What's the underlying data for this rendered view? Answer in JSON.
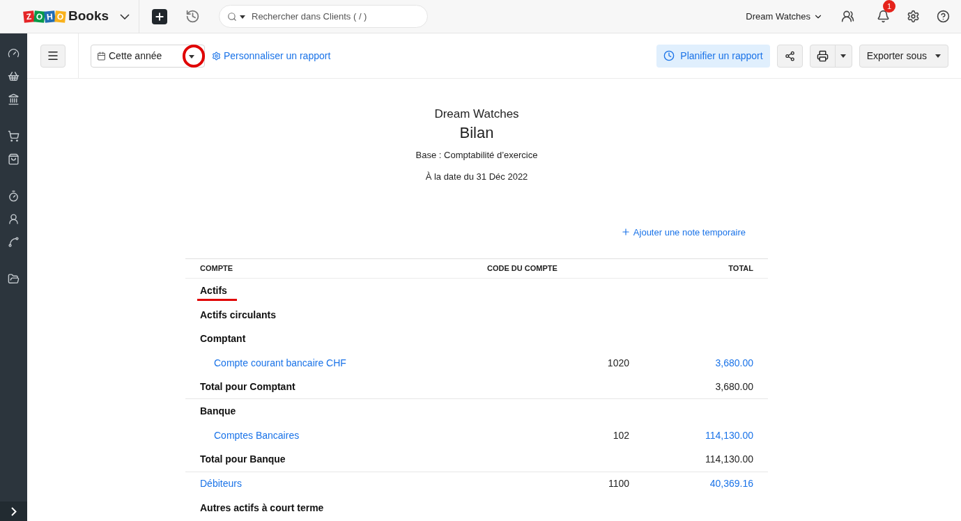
{
  "topbar": {
    "logo_letters": [
      {
        "letter": "Z",
        "color": "#e42527"
      },
      {
        "letter": "O",
        "color": "#089949"
      },
      {
        "letter": "H",
        "color": "#226db4"
      },
      {
        "letter": "O",
        "color": "#f9b21d"
      }
    ],
    "product": "Books",
    "search_placeholder": "Rechercher dans Clients ( / )",
    "organization": "Dream Watches",
    "notification_count": "1"
  },
  "toolbar": {
    "period": "Cette année",
    "customize": "Personnaliser un rapport",
    "schedule": "Planifier un rapport",
    "export": "Exporter sous"
  },
  "report": {
    "company": "Dream Watches",
    "title": "Bilan",
    "basis": "Base : Comptabilité d’exercice",
    "date": "À la date du 31 Déc 2022",
    "add_note": "Ajouter une note temporaire",
    "columns": [
      "COMPTE",
      "CODE DU COMPTE",
      "TOTAL"
    ],
    "rows": [
      {
        "kind": "heading",
        "label": "Actifs"
      },
      {
        "kind": "heading",
        "label": "Actifs circulants"
      },
      {
        "kind": "heading",
        "label": "Comptant"
      },
      {
        "kind": "account",
        "label": "Compte courant bancaire CHF",
        "code": "1020",
        "total": "3,680.00"
      },
      {
        "kind": "total",
        "label": "Total pour Comptant",
        "total": "3,680.00"
      },
      {
        "kind": "heading",
        "label": "Banque"
      },
      {
        "kind": "account",
        "label": "Comptes Bancaires",
        "code": "102",
        "total": "114,130.00"
      },
      {
        "kind": "total",
        "label": "Total pour Banque",
        "total": "114,130.00"
      },
      {
        "kind": "ledger",
        "label": "Débiteurs",
        "code": "1100",
        "total": "40,369.16"
      },
      {
        "kind": "heading",
        "label": "Autres actifs à court terme"
      }
    ]
  }
}
